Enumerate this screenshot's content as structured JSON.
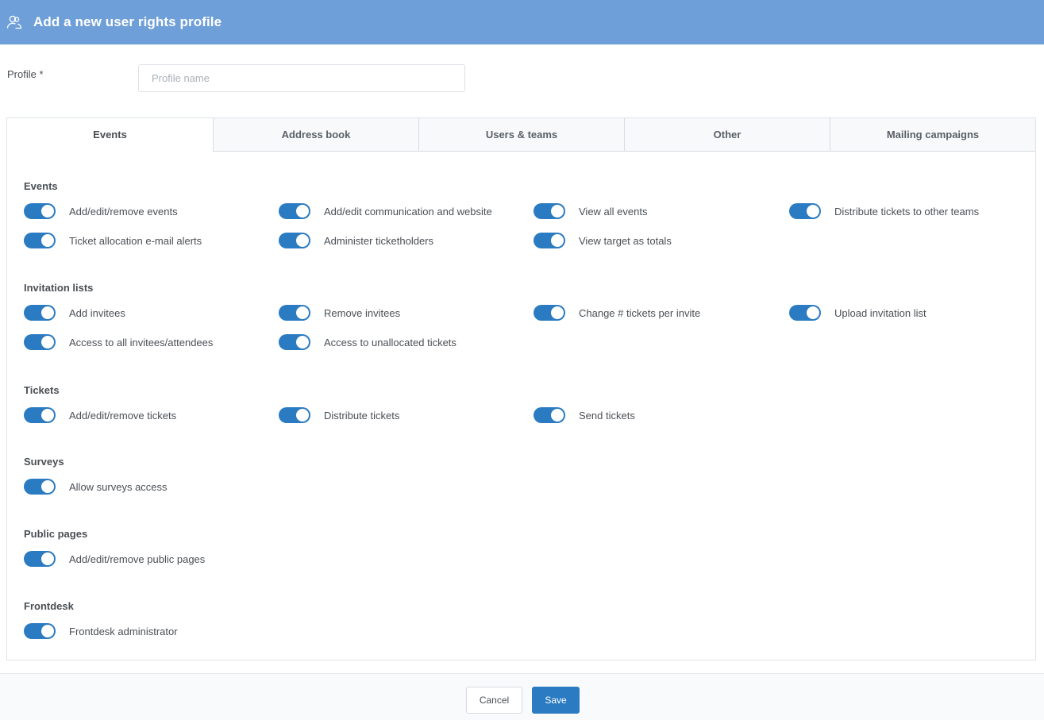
{
  "header": {
    "title": "Add a new user rights profile",
    "icon": "user-profile-icon"
  },
  "profile": {
    "label": "Profile *",
    "placeholder": "Profile name",
    "value": ""
  },
  "tabs": [
    {
      "label": "Events",
      "active": true
    },
    {
      "label": "Address book",
      "active": false
    },
    {
      "label": "Users & teams",
      "active": false
    },
    {
      "label": "Other",
      "active": false
    },
    {
      "label": "Mailing campaigns",
      "active": false
    }
  ],
  "sections": [
    {
      "title": "Events",
      "items": [
        {
          "label": "Add/edit/remove events",
          "on": true
        },
        {
          "label": "Add/edit communication and website",
          "on": true
        },
        {
          "label": "View all events",
          "on": true
        },
        {
          "label": "Distribute tickets to other teams",
          "on": true
        },
        {
          "label": "Ticket allocation e-mail alerts",
          "on": true
        },
        {
          "label": "Administer ticketholders",
          "on": true
        },
        {
          "label": "View target as totals",
          "on": true
        }
      ]
    },
    {
      "title": "Invitation lists",
      "items": [
        {
          "label": "Add invitees",
          "on": true
        },
        {
          "label": "Remove invitees",
          "on": true
        },
        {
          "label": "Change # tickets per invite",
          "on": true
        },
        {
          "label": "Upload invitation list",
          "on": true
        },
        {
          "label": "Access to all invitees/attendees",
          "on": true
        },
        {
          "label": "Access to unallocated tickets",
          "on": true
        }
      ]
    },
    {
      "title": "Tickets",
      "items": [
        {
          "label": "Add/edit/remove tickets",
          "on": true
        },
        {
          "label": "Distribute tickets",
          "on": true
        },
        {
          "label": "Send tickets",
          "on": true
        }
      ]
    },
    {
      "title": "Surveys",
      "items": [
        {
          "label": "Allow surveys access",
          "on": true
        }
      ]
    },
    {
      "title": "Public pages",
      "items": [
        {
          "label": "Add/edit/remove public pages",
          "on": true
        }
      ]
    },
    {
      "title": "Frontdesk",
      "items": [
        {
          "label": "Frontdesk administrator",
          "on": true
        }
      ]
    }
  ],
  "footer": {
    "cancel_label": "Cancel",
    "save_label": "Save"
  },
  "colors": {
    "header": "#6f9fd8",
    "toggle_on": "#2b7bc2",
    "save_button": "#2b7bc2"
  }
}
